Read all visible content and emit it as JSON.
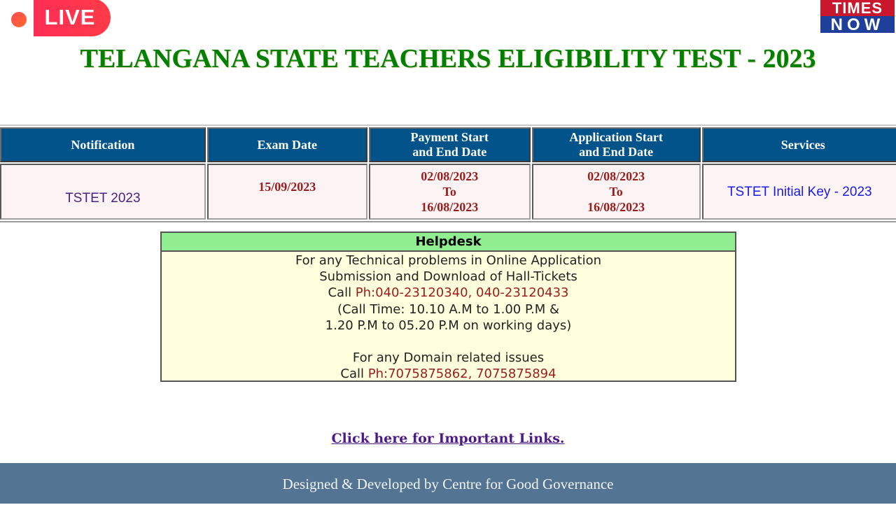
{
  "overlay": {
    "live_label": "LIVE",
    "logo_top": "TIMES",
    "logo_bottom": "NOW"
  },
  "header": {
    "title": "TELANGANA STATE TEACHERS ELIGIBILITY TEST - 2023"
  },
  "table": {
    "headers": {
      "notification": "Notification",
      "exam_date": "Exam Date",
      "payment_line1": "Payment Start",
      "payment_line2": "and End Date",
      "application_line1": "Application Start",
      "application_line2": "and End Date",
      "services": "Services"
    },
    "row": {
      "notification": "TSTET 2023",
      "exam_date": "15/09/2023",
      "payment_start": "02/08/2023",
      "payment_to": "To",
      "payment_end": "16/08/2023",
      "application_start": "02/08/2023",
      "application_to": "To",
      "application_end": "16/08/2023",
      "service_link": "TSTET Initial Key - 2023"
    }
  },
  "helpdesk": {
    "title": "Helpdesk",
    "line1": "For any Technical problems in Online Application",
    "line2": "Submission and Download of Hall-Tickets",
    "call_prefix1": "Call ",
    "phones1": "Ph:040-23120340, 040-23120433",
    "line4": "(Call Time: 10.10 A.M to 1.00 P.M &",
    "line5": "1.20 P.M to 05.20 P.M on working days)",
    "line6": "For any Domain related issues",
    "call_prefix2": "Call ",
    "phones2": "Ph:7075875862, 7075875894"
  },
  "links": {
    "important": "Click here for Important Links."
  },
  "footer": {
    "text": "Designed & Developed by Centre for Good Governance"
  },
  "colors": {
    "title_green": "#008000",
    "table_header_bg": "#02538a",
    "helpdesk_header_bg": "#90ee90",
    "helpdesk_body_bg": "#ffffdd",
    "footer_bg": "#537593",
    "date_red": "#9b1c1c"
  }
}
